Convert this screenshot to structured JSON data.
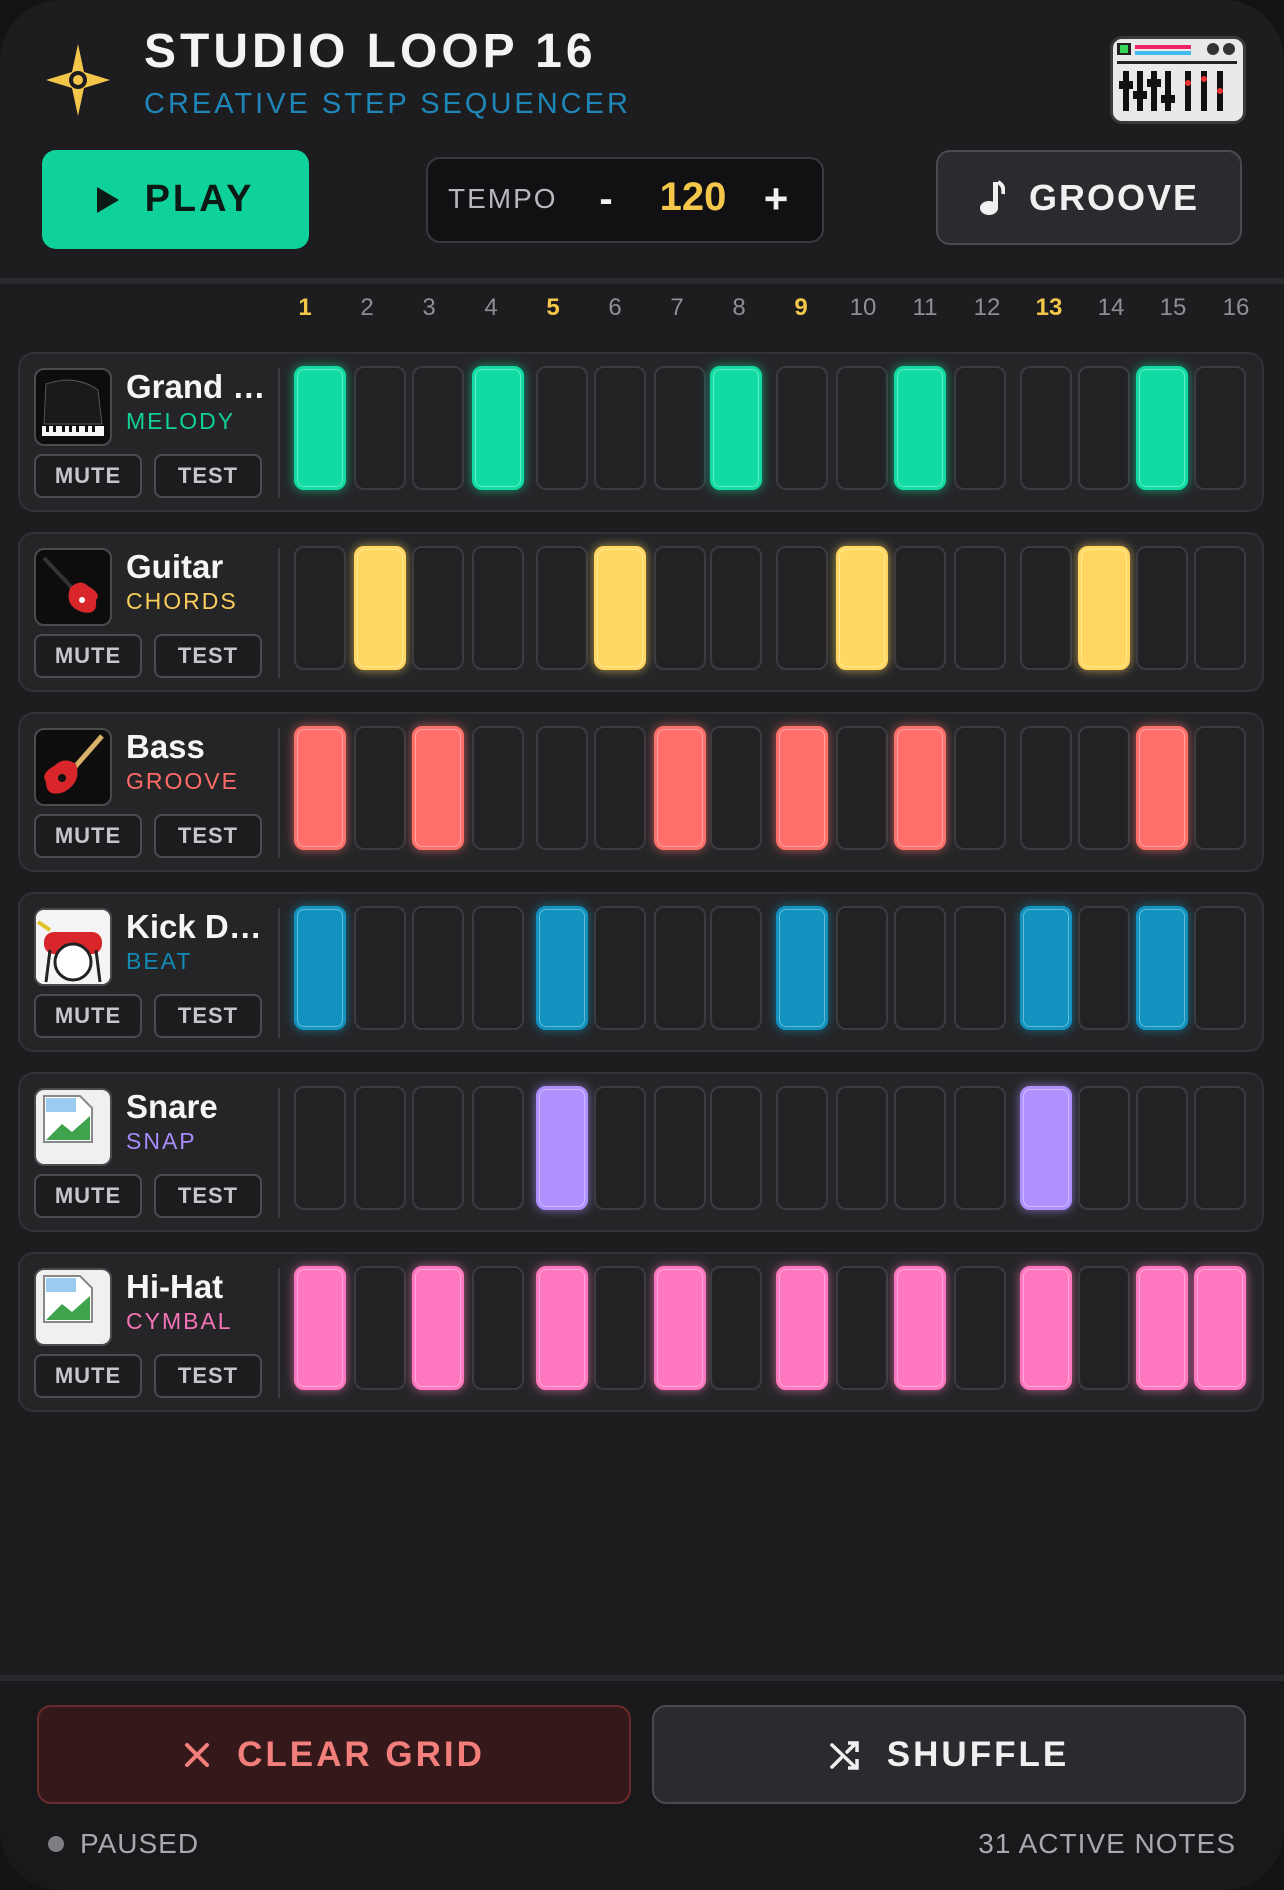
{
  "header": {
    "title": "STUDIO LOOP 16",
    "subtitle": "CREATIVE STEP SEQUENCER",
    "logo_icon": "sparkle-star-icon",
    "device_icon": "drum-machine-icon"
  },
  "controls": {
    "play_label": "PLAY",
    "tempo_label": "TEMPO",
    "tempo_minus": "-",
    "tempo_value": "120",
    "tempo_plus": "+",
    "groove_label": "GROOVE"
  },
  "steps": [
    "1",
    "2",
    "3",
    "4",
    "5",
    "6",
    "7",
    "8",
    "9",
    "10",
    "11",
    "12",
    "13",
    "14",
    "15",
    "16"
  ],
  "accent_steps": [
    1,
    5,
    9,
    13
  ],
  "tracks": [
    {
      "name": "Grand …",
      "category": "MELODY",
      "color": "#0fd19a",
      "icon": "grand-piano-icon",
      "mute": "MUTE",
      "test": "TEST",
      "pattern": [
        1,
        0,
        0,
        1,
        0,
        0,
        0,
        1,
        0,
        0,
        1,
        0,
        0,
        0,
        1,
        0
      ]
    },
    {
      "name": "Guitar",
      "category": "CHORDS",
      "color": "#f9cd5c",
      "icon": "electric-guitar-icon",
      "mute": "MUTE",
      "test": "TEST",
      "pattern": [
        0,
        1,
        0,
        0,
        0,
        1,
        0,
        0,
        0,
        1,
        0,
        0,
        0,
        1,
        0,
        0
      ]
    },
    {
      "name": "Bass",
      "category": "GROOVE",
      "color": "#ff6b66",
      "icon": "bass-guitar-icon",
      "mute": "MUTE",
      "test": "TEST",
      "pattern": [
        1,
        0,
        1,
        0,
        0,
        0,
        1,
        0,
        1,
        0,
        1,
        0,
        0,
        0,
        1,
        0
      ]
    },
    {
      "name": "Kick Dr…",
      "category": "BEAT",
      "color": "#118bb6",
      "icon": "drum-kit-icon",
      "mute": "MUTE",
      "test": "TEST",
      "pattern": [
        1,
        0,
        0,
        0,
        1,
        0,
        0,
        0,
        1,
        0,
        0,
        0,
        1,
        0,
        1,
        0
      ]
    },
    {
      "name": "Snare",
      "category": "SNAP",
      "color": "#a78bfa",
      "icon": "broken-image-icon",
      "mute": "MUTE",
      "test": "TEST",
      "pattern": [
        0,
        0,
        0,
        0,
        1,
        0,
        0,
        0,
        0,
        0,
        0,
        0,
        1,
        0,
        0,
        0
      ]
    },
    {
      "name": "Hi-Hat",
      "category": "CYMBAL",
      "color": "#f472b6",
      "icon": "broken-image-icon",
      "mute": "MUTE",
      "test": "TEST",
      "pattern": [
        1,
        0,
        1,
        0,
        1,
        0,
        1,
        0,
        1,
        0,
        1,
        0,
        1,
        0,
        1,
        1
      ]
    }
  ],
  "footer": {
    "clear_label": "CLEAR GRID",
    "shuffle_label": "SHUFFLE",
    "status": "PAUSED",
    "notes": "31 ACTIVE NOTES"
  }
}
